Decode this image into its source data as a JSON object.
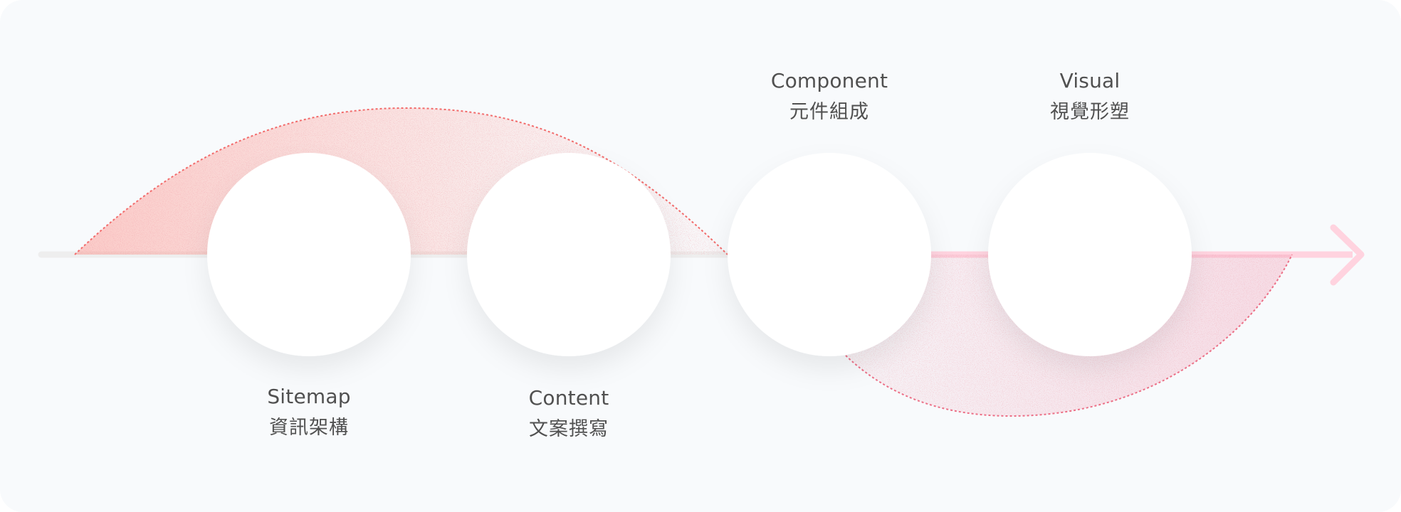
{
  "steps": [
    {
      "en": "Sitemap",
      "zh": "資訊架構"
    },
    {
      "en": "Content",
      "zh": "文案撰寫"
    },
    {
      "en": "Component",
      "zh": "元件組成"
    },
    {
      "en": "Visual",
      "zh": "視覺形塑"
    }
  ],
  "colors": {
    "background": "#f8fafc",
    "circle": "#ffffff",
    "text": "#505050",
    "upper_arc_fill": "#ff8a80",
    "upper_arc_dash": "#f26b6b",
    "lower_arc_fill": "#f3a6bd",
    "lower_arc_dash": "#ec6f86",
    "arrow": "#ffd3df",
    "track_left": "#eeeeee"
  },
  "icons": [
    "arrow-right-icon"
  ]
}
